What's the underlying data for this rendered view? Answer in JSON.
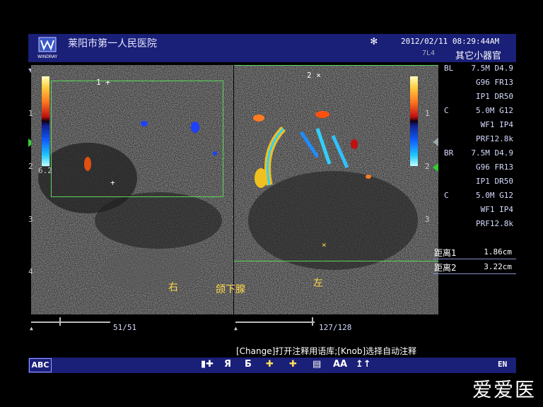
{
  "header": {
    "logo_text": "WINDRAY",
    "hospital": "莱阳市第一人民医院",
    "datetime": "2012/02/11 08:29:44AM",
    "probe": "7L4",
    "preset": "其它小器官"
  },
  "params": [
    {
      "l": "BL",
      "r": "7.5M  D4.9"
    },
    {
      "l": "",
      "r": "G96  FR13"
    },
    {
      "l": "",
      "r": "IP1  DR50"
    },
    {
      "l": "C",
      "r": "5.0M  G12"
    },
    {
      "l": "",
      "r": "WF1  IP4"
    },
    {
      "l": "",
      "r": "PRF12.8k"
    },
    {
      "l": "BR",
      "r": "7.5M  D4.9"
    },
    {
      "l": "",
      "r": "G96  FR13"
    },
    {
      "l": "",
      "r": "IP1  DR50"
    },
    {
      "l": "C",
      "r": "5.0M  G12"
    },
    {
      "l": "",
      "r": "WF1  IP4"
    },
    {
      "l": "",
      "r": "PRF12.8k"
    }
  ],
  "measurements": [
    {
      "label": "距离1",
      "value": "1.86cm"
    },
    {
      "label": "距离2",
      "value": "3.22cm"
    }
  ],
  "left_panel": {
    "marker_top": "1 +",
    "scale": [
      "1",
      "2",
      "3",
      "4"
    ],
    "color_scale_value": "6.2",
    "frame": "51/51"
  },
  "right_panel": {
    "marker_top": "2 ×",
    "scale": [
      "1",
      "2",
      "3"
    ],
    "frame": "127/128"
  },
  "annotations": {
    "right": "右",
    "center": "颌下腺",
    "left": "左"
  },
  "hint": "[Change]打开注释用语库;[Knob]选择自动注释",
  "toolbar": {
    "abc": "ABC",
    "tools": [
      "▮✚",
      "Я",
      "Ƃ",
      "✚",
      "✚",
      "▤",
      "AA",
      "↥↑"
    ],
    "lang": "EN"
  },
  "watermark": "爱爱医",
  "colors": {
    "header_bg": "#1a1f78",
    "roi": "#5cd65c",
    "annotation": "#ffd84a"
  }
}
